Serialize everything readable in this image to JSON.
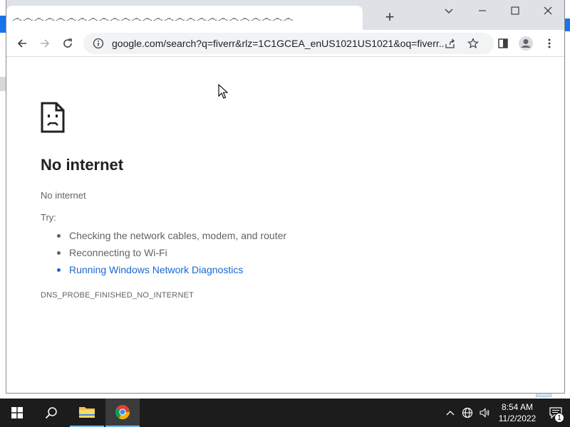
{
  "browser": {
    "tab": {
      "title": "෴෴෴෴෴෴෴෴෴෴෴෴෴෴෴෴෴෴෴෴෴෴෴෴෴෴"
    },
    "address_bar": {
      "url": "google.com/search?q=fiverr&rlz=1C1GCEA_enUS1021US1021&oq=fiverr..."
    }
  },
  "error_page": {
    "heading": "No internet",
    "subtitle": "No internet",
    "try_label": "Try:",
    "suggestions": [
      {
        "text": "Checking the network cables, modem, and router",
        "is_link": false
      },
      {
        "text": "Reconnecting to Wi-Fi",
        "is_link": false
      },
      {
        "text": "Running Windows Network Diagnostics",
        "is_link": true
      }
    ],
    "error_code": "DNS_PROBE_FINISHED_NO_INTERNET"
  },
  "taskbar": {
    "time": "8:54 AM",
    "date": "11/2/2022",
    "notification_count": "1",
    "pinned_apps": [
      "start-icon",
      "search-icon",
      "file-explorer-icon",
      "chrome-icon"
    ]
  },
  "colors": {
    "link": "#1967d2",
    "tabstrip": "#dee1e6",
    "taskbar": "#1c1c1c",
    "accent": "#76b9ed"
  }
}
